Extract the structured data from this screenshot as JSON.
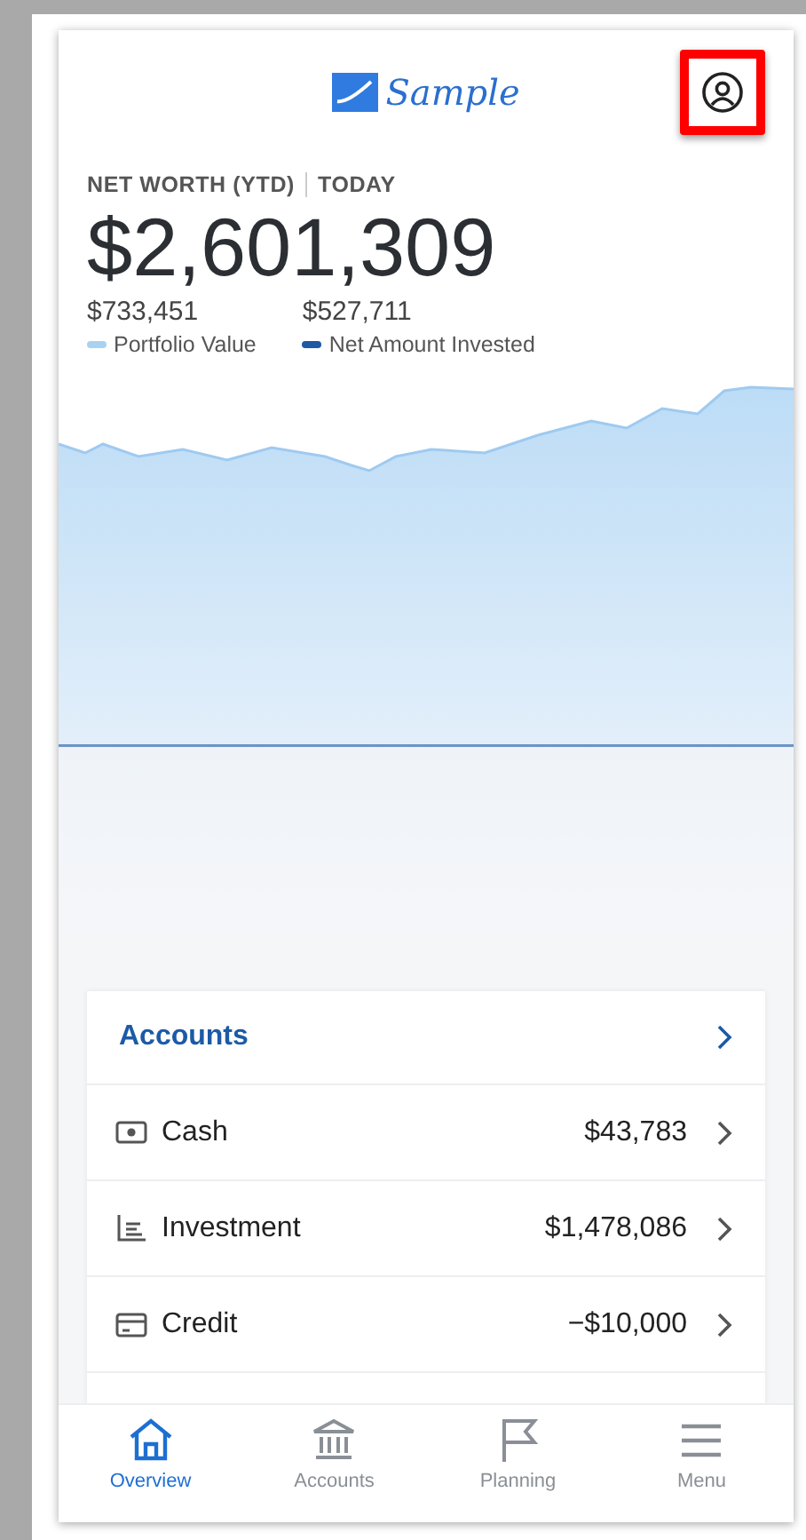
{
  "header": {
    "logo": "Sample",
    "profile_highlighted": true
  },
  "summary": {
    "label": "NET WORTH (YTD)",
    "period": "TODAY",
    "total": "$2,601,309",
    "legend": [
      {
        "value": "$733,451",
        "name": "Portfolio Value",
        "color": "#a9d2f2"
      },
      {
        "value": "$527,711",
        "name": "Net Amount Invested",
        "color": "#1c5aa6"
      }
    ]
  },
  "accounts": {
    "title": "Accounts",
    "rows": [
      {
        "kind": "cash",
        "name": "Cash",
        "amount": "$43,783"
      },
      {
        "kind": "investment",
        "name": "Investment",
        "amount": "$1,478,086"
      },
      {
        "kind": "credit",
        "name": "Credit",
        "amount": "−$10,000"
      }
    ]
  },
  "tabs": [
    {
      "kind": "home",
      "label": "Overview",
      "selected": true
    },
    {
      "kind": "bank",
      "label": "Accounts",
      "selected": false
    },
    {
      "kind": "flag",
      "label": "Planning",
      "selected": false
    },
    {
      "kind": "menu",
      "label": "Menu",
      "selected": false
    }
  ]
}
